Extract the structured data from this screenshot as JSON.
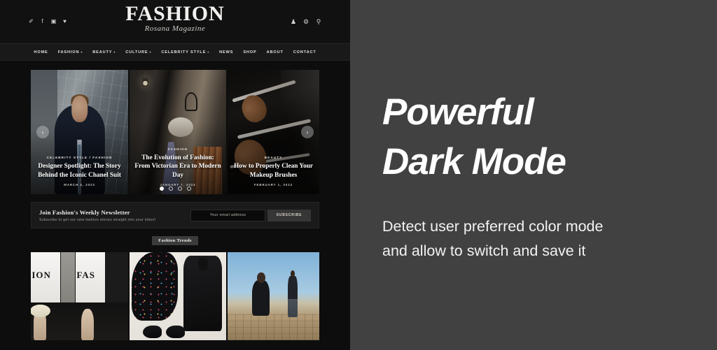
{
  "site": {
    "social_icons": [
      {
        "name": "twitter-icon",
        "glyph": "✐"
      },
      {
        "name": "facebook-icon",
        "glyph": "f"
      },
      {
        "name": "instagram-icon",
        "glyph": "▣"
      },
      {
        "name": "heart-icon",
        "glyph": "♥"
      }
    ],
    "brand": {
      "name": "FASHION",
      "tagline": "Rosana Magazine"
    },
    "header_icons": [
      {
        "name": "account-icon",
        "glyph": "♟"
      },
      {
        "name": "settings-gear-icon",
        "glyph": "⚙"
      },
      {
        "name": "search-icon",
        "glyph": "⚲"
      }
    ],
    "nav": [
      {
        "label": "HOME",
        "has_dropdown": false
      },
      {
        "label": "FASHION",
        "has_dropdown": true
      },
      {
        "label": "BEAUTY",
        "has_dropdown": true
      },
      {
        "label": "CULTURE",
        "has_dropdown": true
      },
      {
        "label": "CELEBRITY STYLE",
        "has_dropdown": true
      },
      {
        "label": "NEWS",
        "has_dropdown": false
      },
      {
        "label": "SHOP",
        "has_dropdown": false
      },
      {
        "label": "ABOUT",
        "has_dropdown": false
      },
      {
        "label": "CONTACT",
        "has_dropdown": false
      }
    ],
    "carousel": {
      "prev_label": "‹",
      "next_label": "›",
      "slides": [
        {
          "category": "CELEBRITY STYLE / FASHION",
          "title": "Designer Spotlight: The Story Behind the Iconic Chanel Suit",
          "date": "MARCH 4, 2023"
        },
        {
          "category": "FASHION",
          "title": "The Evolution of Fashion: From Victorian Era to Modern Day",
          "date": "JANUARY 7, 2023"
        },
        {
          "category": "BEAUTY",
          "title": "How to Properly Clean Your Makeup Brushes",
          "date": "FEBRUARY 1, 2023"
        }
      ],
      "dot_count": 4,
      "active_dot": 0
    },
    "newsletter": {
      "title": "Join Fashion's Weekly Newsletter",
      "subtitle": "Subscribe to get our new fashion stories straight into your inbox!",
      "email_placeholder": "Your email address",
      "email_value": "",
      "button_label": "SUBSCRIBE"
    },
    "section_badge": "Fashion Trends"
  },
  "feature": {
    "heading_line1": "Powerful",
    "heading_line2": "Dark Mode",
    "body_line1": "Detect user preferred color mode",
    "body_line2": "and allow to switch and save it"
  },
  "colors": {
    "panel_background": "#414141",
    "site_background": "#0d0d0d",
    "header_background": "#111111",
    "nav_background": "#191919",
    "newsletter_background": "#1a1a1a",
    "badge_background": "#3b3b3b",
    "accent_text": "#ffffff"
  }
}
